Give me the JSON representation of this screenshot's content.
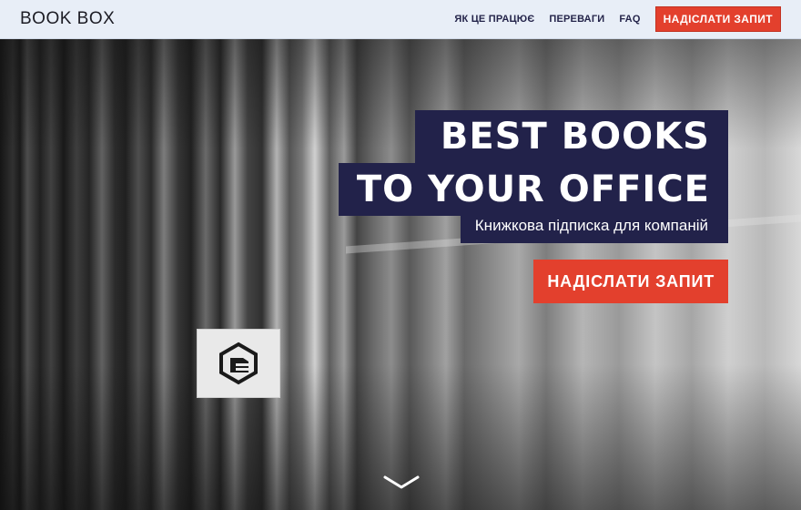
{
  "header": {
    "logo": "BOOK BOX",
    "nav": [
      {
        "label": "ЯК ЦЕ ПРАЦЮЄ"
      },
      {
        "label": "ПЕРЕВАГИ"
      },
      {
        "label": "FAQ"
      }
    ],
    "cta_label": "НАДІСЛАТИ ЗАПИТ"
  },
  "hero": {
    "title_line1": "BEST BOOKS",
    "title_line2": "TO YOUR OFFICE",
    "subtitle": "Книжкова підписка для компаній",
    "cta_label": "НАДІСЛАТИ ЗАПИТ",
    "scroll_icon": "chevron-down-icon",
    "tag_icon": "hexagon-logo-icon"
  },
  "colors": {
    "accent": "#e3402d",
    "navy": "#22224a",
    "header_bg": "#e8eef7"
  }
}
